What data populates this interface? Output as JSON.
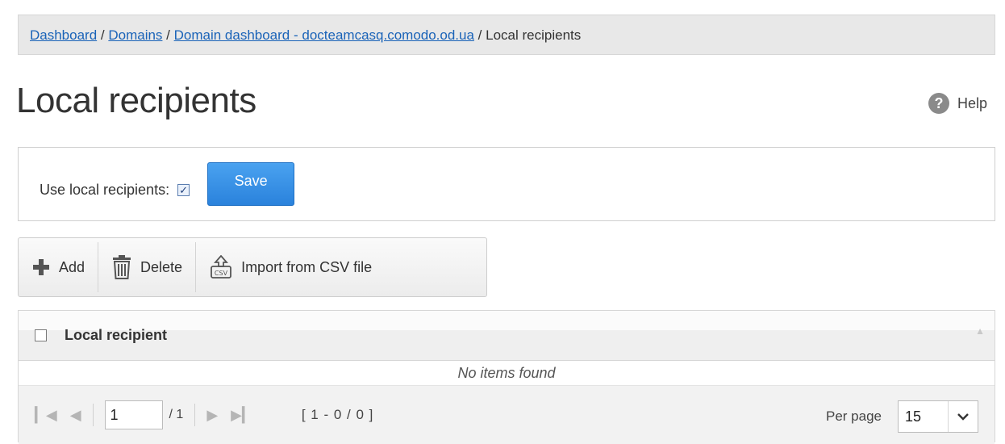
{
  "breadcrumb": {
    "items": [
      {
        "label": "Dashboard",
        "link": true
      },
      {
        "label": "Domains",
        "link": true
      },
      {
        "label": "Domain dashboard - docteamcasq.comodo.od.ua",
        "link": true
      },
      {
        "label": "Local recipients",
        "link": false
      }
    ],
    "separator": " / "
  },
  "page": {
    "title": "Local recipients",
    "help_label": "Help",
    "help_icon": "question-mark-icon"
  },
  "settings": {
    "use_local_recipients_label": "Use local recipients:",
    "use_local_recipients_checked": true,
    "save_label": "Save"
  },
  "toolbar": {
    "add_label": "Add",
    "delete_label": "Delete",
    "import_label": "Import from CSV file"
  },
  "grid": {
    "column_header": "Local recipient",
    "empty_text": "No items found",
    "rows": []
  },
  "pager": {
    "current_page": "1",
    "total_pages_text": "/ 1",
    "range_text": "[ 1 - 0 / 0 ]",
    "per_page_label": "Per page",
    "per_page_value": "15"
  },
  "colors": {
    "link": "#1a63b8",
    "primary_button": "#2a82dc",
    "breadcrumb_bg": "#e8e8e8",
    "add_icon": "#555555"
  }
}
